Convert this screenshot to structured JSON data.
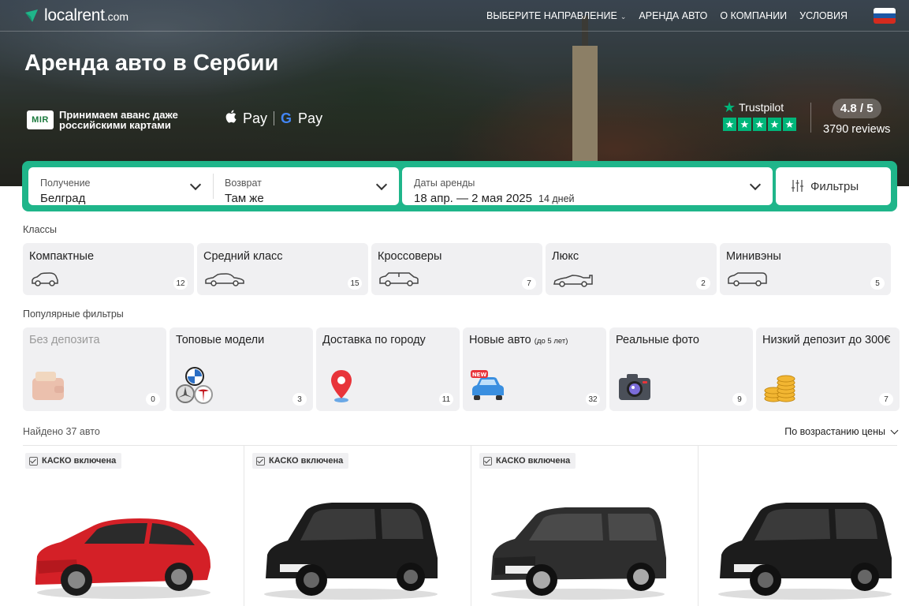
{
  "header": {
    "logo_text": "localrent",
    "logo_suffix": ".com",
    "nav": [
      {
        "label": "ВЫБЕРИТЕ НАПРАВЛЕНИЕ",
        "has_dropdown": true
      },
      {
        "label": "АРЕНДА АВТО"
      },
      {
        "label": "О КОМПАНИИ"
      },
      {
        "label": "УСЛОВИЯ"
      }
    ],
    "language_flag": "ru-flag-icon"
  },
  "hero": {
    "title": "Аренда авто в Сербии",
    "mir_logo": "MIR",
    "mir_text": "Принимаем аванс даже российскими картами",
    "apple_pay": "Pay",
    "google_pay": "Pay",
    "trustpilot": "Trustpilot",
    "stars": 5,
    "rating": "4.8 / 5",
    "reviews": "3790 reviews"
  },
  "search": {
    "pickup_label": "Получение",
    "pickup_value": "Белград",
    "return_label": "Возврат",
    "return_value": "Там же",
    "dates_label": "Даты аренды",
    "dates_value": "18 апр. — 2 мая 2025",
    "days": "14 дней",
    "filters_label": "Фильтры",
    "accent_color": "#1fb58a"
  },
  "classes": {
    "label": "Классы",
    "items": [
      {
        "name": "Компактные",
        "count": "12",
        "icon": "compact-car-icon"
      },
      {
        "name": "Средний класс",
        "count": "15",
        "icon": "sedan-car-icon"
      },
      {
        "name": "Кроссоверы",
        "count": "7",
        "icon": "suv-car-icon"
      },
      {
        "name": "Люкс",
        "count": "2",
        "icon": "sports-car-icon"
      },
      {
        "name": "Минивэны",
        "count": "5",
        "icon": "minivan-icon"
      }
    ]
  },
  "popular_filters": {
    "label": "Популярные фильтры",
    "items": [
      {
        "name": "Без депозита",
        "count": "0",
        "icon": "wallet-icon",
        "disabled": true
      },
      {
        "name": "Топовые модели",
        "count": "3",
        "icon": "brand-logos-icon"
      },
      {
        "name": "Доставка по городу",
        "count": "11",
        "icon": "map-pin-icon"
      },
      {
        "name": "Новые авто",
        "note": "(до 5 лет)",
        "count": "32",
        "icon": "new-car-icon"
      },
      {
        "name": "Реальные фото",
        "count": "9",
        "icon": "camera-icon"
      },
      {
        "name": "Низкий депозит до 300€",
        "count": "7",
        "icon": "coins-icon"
      }
    ]
  },
  "results": {
    "found": "Найдено 37 авто",
    "sort": "По возрастанию цены",
    "cars": [
      {
        "badge": "КАСКО включена",
        "color": "#d42027"
      },
      {
        "badge": "КАСКО включена",
        "color": "#1c1c1c"
      },
      {
        "badge": "КАСКО включена",
        "color": "#2a2a2a"
      },
      {
        "badge": "",
        "color": "#1c1c1c"
      }
    ]
  }
}
